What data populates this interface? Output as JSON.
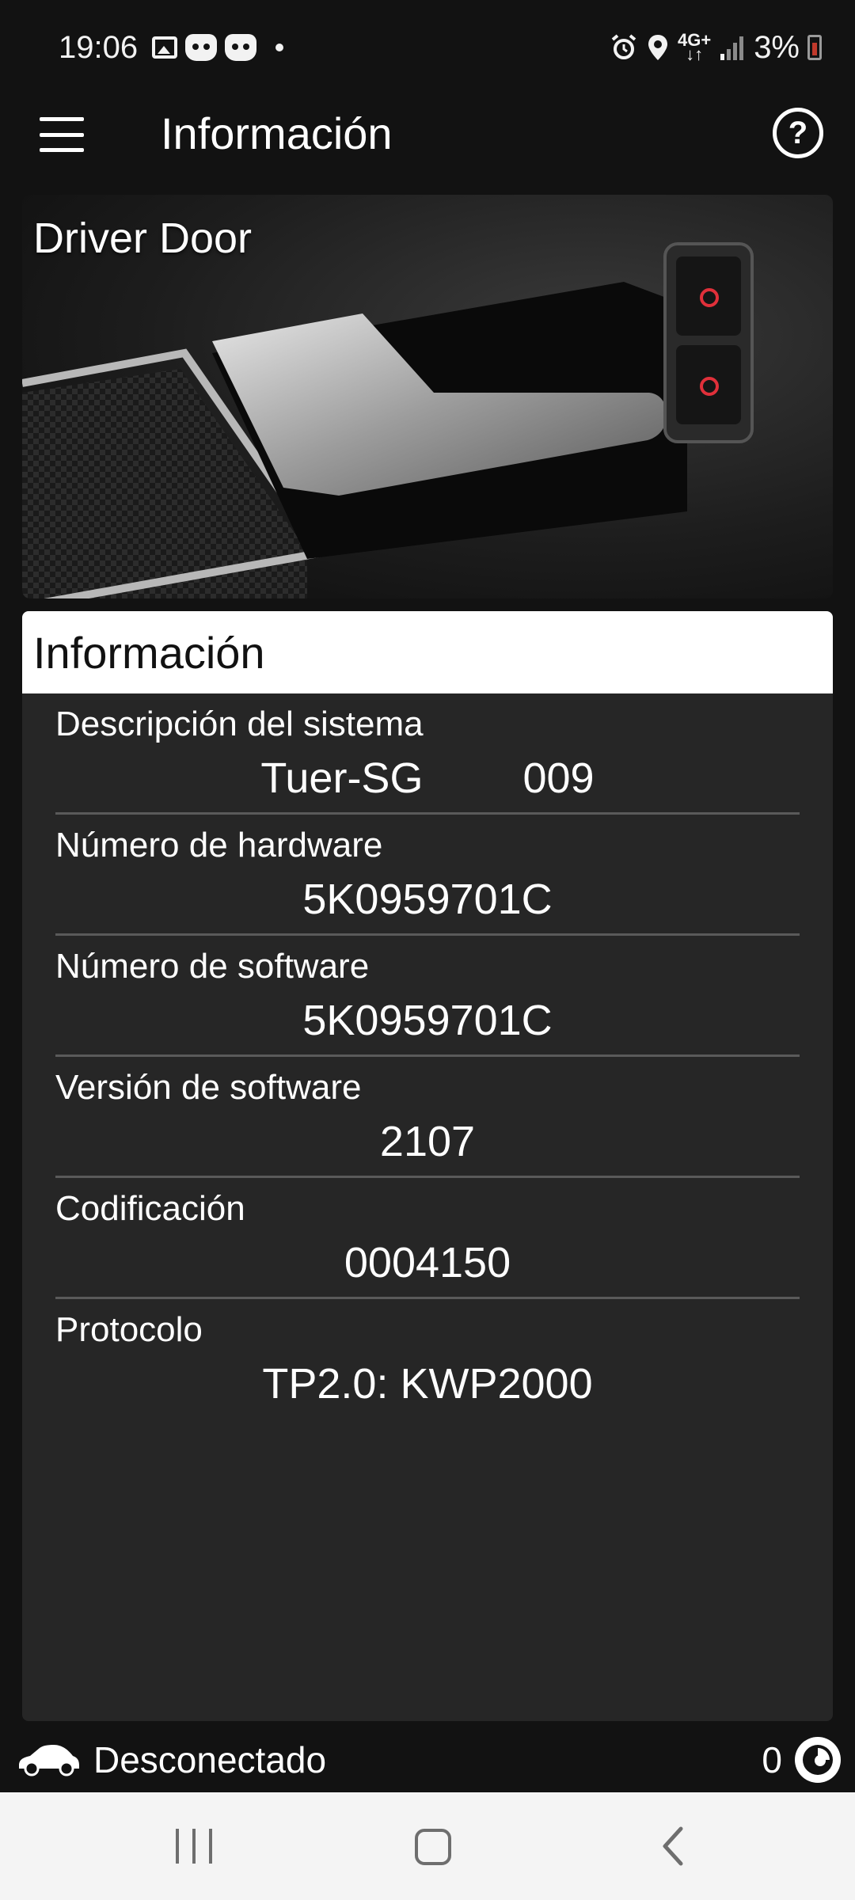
{
  "status_bar": {
    "time": "19:06",
    "network": "4G+",
    "battery": "3%",
    "icons": [
      "image-icon",
      "cat-face-icon",
      "cat-face-icon",
      "dot-icon",
      "alarm-icon",
      "location-icon",
      "network-4g-icon",
      "signal-icon",
      "battery-icon"
    ]
  },
  "app_bar": {
    "title": "Información",
    "menu_icon": "hamburger-menu-icon",
    "help_icon": "help-circle-icon"
  },
  "hero": {
    "title": "Driver Door",
    "image": "car-door-handle-photo"
  },
  "info": {
    "header": "Información",
    "rows": [
      {
        "label": "Descripción del sistema",
        "value": "Tuer-SG",
        "value2": "009"
      },
      {
        "label": "Número de hardware",
        "value": "5K0959701C"
      },
      {
        "label": "Número de software",
        "value": "5K0959701C"
      },
      {
        "label": "Versión de software",
        "value": "2107"
      },
      {
        "label": "Codificación",
        "value": "0004150"
      },
      {
        "label": "Protocolo",
        "value": "TP2.0: KWP2000"
      }
    ]
  },
  "connection": {
    "status": "Desconectado",
    "count": "0",
    "car_icon": "car-icon",
    "connect_icon": "connection-icon"
  },
  "nav_bar": {
    "items": [
      "recent-apps-icon",
      "home-icon",
      "back-icon"
    ]
  },
  "colors": {
    "background": "#121212",
    "card": "#262626",
    "header_bg": "#ffffff",
    "divider": "#5a5a5a",
    "nav_bg": "#f4f4f4"
  }
}
